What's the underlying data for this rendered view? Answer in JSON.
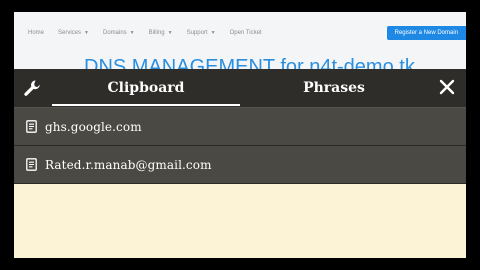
{
  "site": {
    "nav": [
      "Home",
      "Services",
      "Domains",
      "Billing",
      "Support",
      "Open Ticket"
    ],
    "nav_caret": [
      false,
      true,
      true,
      true,
      true,
      false
    ],
    "register_label": "Register a New Domain",
    "heading": "DNS MANAGEMENT for n4t-demo.tk"
  },
  "clipboard": {
    "tabs": [
      "Clipboard",
      "Phrases"
    ],
    "active_tab": "Clipboard",
    "items": [
      "ghs.google.com",
      "Rated.r.manab@gmail.com"
    ]
  },
  "icons": {
    "settings": "wrench-icon",
    "close": "close-icon",
    "item": "document-icon"
  },
  "colors": {
    "accent": "#2b8fe0",
    "toolbar": "#2f2d2a",
    "item_bg": "#4b4943",
    "panel_bg": "#fcf2d6"
  }
}
